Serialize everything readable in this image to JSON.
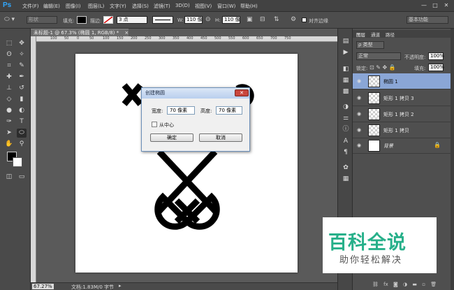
{
  "app": {
    "logo": "Ps"
  },
  "menubar": {
    "items": [
      "文件(F)",
      "编辑(E)",
      "图像(I)",
      "图层(L)",
      "文字(Y)",
      "选择(S)",
      "滤镜(T)",
      "3D(D)",
      "视图(V)",
      "窗口(W)",
      "帮助(H)"
    ],
    "minimize": "—",
    "maximize": "□",
    "close": "✕"
  },
  "options": {
    "shape_mode": "形状",
    "fill_label": "填充:",
    "stroke_label": "描边:",
    "stroke_width": "3 点",
    "w_label": "W:",
    "w_value": "110 像",
    "h_label": "H:",
    "h_value": "110 像",
    "align_edges": "对齐边缘",
    "workspace": "基本功能"
  },
  "document": {
    "tab_title": "未标题-1 @ 67.3% (椭圆 1, RGB/8) *",
    "tab_close": "×",
    "ruler_ticks": [
      "100",
      "50",
      "0",
      "50",
      "100",
      "150",
      "200",
      "250",
      "300",
      "350",
      "400",
      "450",
      "500",
      "550",
      "600",
      "650",
      "700",
      "750"
    ]
  },
  "status": {
    "zoom": "67.27%",
    "doc_info": "文档:1.83M/0 字节"
  },
  "dialog": {
    "title": "创建椭圆",
    "close": "✕",
    "width_label": "宽度:",
    "width_value": "70 像素",
    "height_label": "高度:",
    "height_value": "70 像素",
    "from_center": "从中心",
    "ok": "确定",
    "cancel": "取消"
  },
  "layers_panel": {
    "tabs": [
      "图层",
      "通道",
      "路径"
    ],
    "filter_kind": "ρ 类型",
    "blend_mode": "正常",
    "opacity_label": "不透明度:",
    "opacity_value": "100%",
    "lock_label": "锁定:",
    "fill_label": "填充:",
    "fill_value": "100%",
    "layers": [
      {
        "name": "椭圆 1",
        "selected": true
      },
      {
        "name": "矩形 1 拷贝 3",
        "selected": false
      },
      {
        "name": "矩形 1 拷贝 2",
        "selected": false
      },
      {
        "name": "矩形 1 拷贝",
        "selected": false
      },
      {
        "name": "背景",
        "selected": false
      }
    ],
    "bottom_icons": [
      "link-icon",
      "fx-icon",
      "mask-icon",
      "adjustment-icon",
      "folder-icon",
      "new-layer-icon",
      "trash-icon"
    ]
  },
  "watermark": {
    "main": "百科全说",
    "sub": "助你轻松解决"
  },
  "colors": {
    "accent": "#31a8ff",
    "selected_layer": "#8aa6d6",
    "watermark_green": "#27b08a",
    "dialog_close": "#c9463d"
  }
}
